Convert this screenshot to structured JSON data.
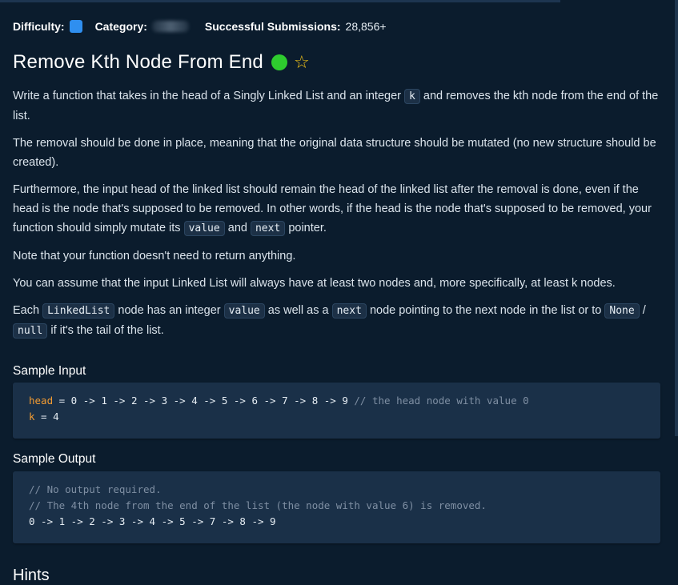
{
  "meta": {
    "difficulty_label": "Difficulty:",
    "difficulty_color": "#2f8ff0",
    "category_label": "Category:",
    "submissions_label": "Successful Submissions:",
    "submissions_value": "28,856+"
  },
  "question": {
    "title": "Remove Kth Node From End",
    "status_color": "#2ecc2e",
    "star_icon": "star-outline-icon"
  },
  "description": {
    "p1": {
      "t1": "Write a function that takes in the head of a Singly Linked List and an integer",
      "c1": "k",
      "t2": "and removes the kth node from the end of the list."
    },
    "p2": "The removal should be done in place, meaning that the original data structure should be mutated (no new structure should be created).",
    "p3": {
      "t1": "Furthermore, the input head of the linked list should remain the head of the linked list after the removal is done, even if the head is the node that's supposed to be removed. In other words, if the head is the node that's supposed to be removed, your function should simply mutate its",
      "c1": "value",
      "t2": "and",
      "c2": "next",
      "t3": "pointer."
    },
    "p4": "Note that your function doesn't need to return anything.",
    "p5": "You can assume that the input Linked List will always have at least two nodes and, more specifically, at least k nodes.",
    "p6": {
      "t1": "Each",
      "c1": "LinkedList",
      "t2": "node has an integer",
      "c2": "value",
      "t3": "as well as a",
      "c3": "next",
      "t4": "node pointing to the next node in the list or to",
      "c4": "None",
      "t5": "/",
      "c5": "null",
      "t6": "if it's the tail of the list."
    }
  },
  "sample_input": {
    "heading": "Sample Input",
    "line1_var": "head",
    "line1_rest": " = 0 -> 1 -> 2 -> 3 -> 4 -> 5 -> 6 -> 7 -> 8 -> 9 ",
    "line1_comment": "// the head node with value 0",
    "line2_var": "k",
    "line2_rest": " = 4"
  },
  "sample_output": {
    "heading": "Sample Output",
    "comment1": "// No output required.",
    "comment2": "// The 4th node from the end of the list (the node with value 6) is removed.",
    "line3": "0 -> 1 -> 2 -> 3 -> 4 -> 5 -> 7 -> 8 -> 9"
  },
  "hints_heading": "Hints"
}
